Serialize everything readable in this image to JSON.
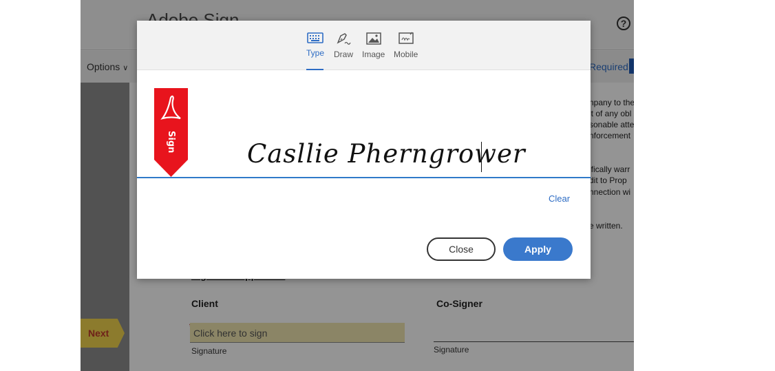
{
  "app": {
    "title": "Adobe Sign",
    "options_label": "Options",
    "required_label": "Required"
  },
  "document": {
    "right_snippets": [
      "npany to the",
      "it of any obl",
      "sonable atte",
      "nforcement",
      "ifically warr",
      "dit to Prop",
      "nnection wi",
      "e written."
    ],
    "section_heading": "Signature Approvals",
    "client_label": "Client",
    "cosigner_label": "Co-Signer",
    "sign_field_placeholder": "Click here to sign",
    "signature_label_client": "Signature",
    "signature_label_cosigner": "Signature",
    "next_label": "Next"
  },
  "dialog": {
    "tabs": [
      {
        "label": "Type",
        "icon": "keyboard-icon",
        "active": true
      },
      {
        "label": "Draw",
        "icon": "pen-icon",
        "active": false
      },
      {
        "label": "Image",
        "icon": "image-icon",
        "active": false
      },
      {
        "label": "Mobile",
        "icon": "mobile-signature-icon",
        "active": false
      }
    ],
    "banner_text": "Sign",
    "signature_value": "Casllie Pherngrower",
    "clear_label": "Clear",
    "close_label": "Close",
    "apply_label": "Apply"
  },
  "colors": {
    "accent": "#2d6cc4",
    "apply_button": "#3a79cc",
    "banner_red": "#e8141d",
    "sign_field": "#efe6b0",
    "next_button": "#f1d44e"
  }
}
